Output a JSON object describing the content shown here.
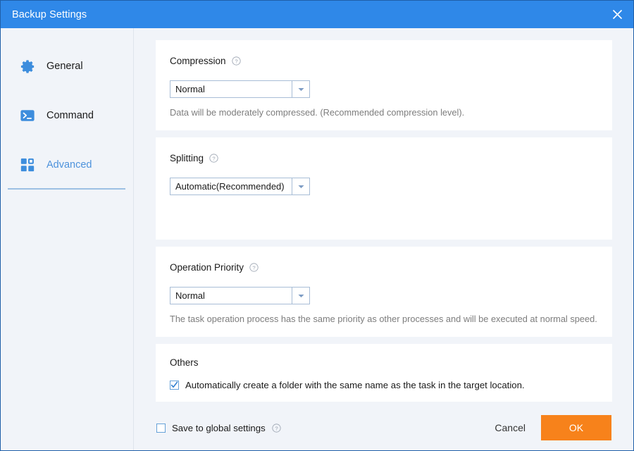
{
  "window": {
    "title": "Backup Settings",
    "close_icon": "close-icon",
    "accent_blue": "#2f88e8",
    "accent_orange": "#f7821b",
    "background": "#f1f4f9"
  },
  "sidebar": {
    "items": [
      {
        "label": "General",
        "icon": "gear-icon",
        "active": false
      },
      {
        "label": "Command",
        "icon": "terminal-icon",
        "active": false
      },
      {
        "label": "Advanced",
        "icon": "grid-icon",
        "active": true
      }
    ]
  },
  "main": {
    "compression": {
      "title": "Compression",
      "help_icon": "help-circle-icon",
      "select_value": "Normal",
      "hint": "Data will be moderately compressed. (Recommended compression level)."
    },
    "splitting": {
      "title": "Splitting",
      "help_icon": "help-circle-icon",
      "select_value": "Automatic(Recommended)"
    },
    "priority": {
      "title": "Operation Priority",
      "help_icon": "help-circle-icon",
      "select_value": "Normal",
      "hint": "The task operation process has the same priority as other processes and will be executed at normal speed."
    },
    "others": {
      "title": "Others",
      "auto_folder_label": "Automatically create a folder with the same name as the task in the target location.",
      "auto_folder_checked": true
    }
  },
  "footer": {
    "save_global_label": "Save to global settings",
    "save_global_checked": false,
    "help_icon": "help-circle-icon",
    "cancel_label": "Cancel",
    "ok_label": "OK"
  }
}
